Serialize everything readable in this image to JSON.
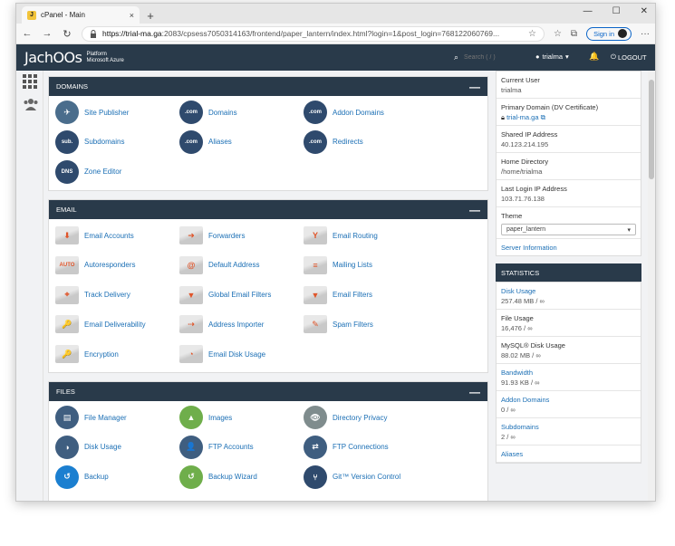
{
  "browser": {
    "tab_title": "cPanel - Main",
    "tab_close": "×",
    "new_tab": "+",
    "win_min": "—",
    "win_max": "☐",
    "win_close": "✕",
    "nav_back": "←",
    "nav_forward": "→",
    "nav_reload": "↻",
    "url_host": "https://trial-ma.ga",
    "url_rest": ":2083/cpsess7050314163/frontend/paper_lantern/index.html?login=1&post_login=768122060769...",
    "signin_label": "Sign in",
    "more": "···"
  },
  "header": {
    "logo": "JachOOs",
    "logo_sub1": "Platform",
    "logo_sub2": "Microsoft Azure",
    "search_icon": "🔍",
    "search_placeholder": "Search ( / )",
    "user": "trialma",
    "user_icon": "👤",
    "caret": "▾",
    "bell": "🔔",
    "logout": "LOGOUT",
    "logout_icon": "⏻"
  },
  "leftbar": {
    "grid_icon": "▦",
    "users_icon": "👥"
  },
  "domains": {
    "title": "DOMAINS",
    "collapse": "—",
    "items": [
      {
        "label": "Site Publisher",
        "glyph": "✈"
      },
      {
        "label": "Domains",
        "glyph": ".com"
      },
      {
        "label": "Addon Domains",
        "glyph": ".com"
      },
      {
        "label": "Subdomains",
        "glyph": "sub."
      },
      {
        "label": "Aliases",
        "glyph": ".com"
      },
      {
        "label": "Redirects",
        "glyph": ".com"
      },
      {
        "label": "Zone Editor",
        "glyph": "DNS"
      }
    ]
  },
  "email": {
    "title": "EMAIL",
    "collapse": "—",
    "items": [
      {
        "label": "Email Accounts",
        "glyph": "⬇"
      },
      {
        "label": "Forwarders",
        "glyph": "➜"
      },
      {
        "label": "Email Routing",
        "glyph": "Y"
      },
      {
        "label": "Autoresponders",
        "glyph": "AUTO"
      },
      {
        "label": "Default Address",
        "glyph": "@"
      },
      {
        "label": "Mailing Lists",
        "glyph": "≡"
      },
      {
        "label": "Track Delivery",
        "glyph": "⌖"
      },
      {
        "label": "Global Email Filters",
        "glyph": "▼"
      },
      {
        "label": "Email Filters",
        "glyph": "▼"
      },
      {
        "label": "Email Deliverability",
        "glyph": "🔑"
      },
      {
        "label": "Address Importer",
        "glyph": "⇢"
      },
      {
        "label": "Spam Filters",
        "glyph": "✎"
      },
      {
        "label": "Encryption",
        "glyph": "🔑"
      },
      {
        "label": "Email Disk Usage",
        "glyph": "◔"
      }
    ]
  },
  "files": {
    "title": "FILES",
    "collapse": "—",
    "items": [
      {
        "label": "File Manager",
        "glyph": "▤"
      },
      {
        "label": "Images",
        "glyph": "▲"
      },
      {
        "label": "Directory Privacy",
        "glyph": "👁"
      },
      {
        "label": "Disk Usage",
        "glyph": "◑"
      },
      {
        "label": "FTP Accounts",
        "glyph": "👤"
      },
      {
        "label": "FTP Connections",
        "glyph": "⇄"
      },
      {
        "label": "Backup",
        "glyph": "↺"
      },
      {
        "label": "Backup Wizard",
        "glyph": "↺"
      },
      {
        "label": "Git™ Version Control",
        "glyph": "⑂"
      }
    ]
  },
  "general": {
    "current_user_label": "Current User",
    "current_user": "trialma",
    "primary_domain_label": "Primary Domain (DV Certificate)",
    "primary_domain": "trial-ma.ga",
    "shared_ip_label": "Shared IP Address",
    "shared_ip": "40.123.214.195",
    "home_dir_label": "Home Directory",
    "home_dir": "/home/trialma",
    "last_login_label": "Last Login IP Address",
    "last_login": "103.71.76.138",
    "theme_label": "Theme",
    "theme_value": "paper_lantern",
    "server_info": "Server Information"
  },
  "stats": {
    "title": "STATISTICS",
    "rows": [
      {
        "label": "Disk Usage",
        "value": "257.48 MB / ∞",
        "link": true
      },
      {
        "label": "File Usage",
        "value": "16,476 / ∞",
        "link": false
      },
      {
        "label": "MySQL® Disk Usage",
        "value": "88.02 MB / ∞",
        "link": false
      },
      {
        "label": "Bandwidth",
        "value": "91.93 KB / ∞",
        "link": true
      },
      {
        "label": "Addon Domains",
        "value": "0 / ∞",
        "link": true
      },
      {
        "label": "Subdomains",
        "value": "2 / ∞",
        "link": true
      },
      {
        "label": "Aliases",
        "value": "",
        "link": true
      }
    ]
  },
  "colors": {
    "header": "#293a4a",
    "link": "#1b6fb5",
    "icon_blue": "#2f4a6d",
    "icon_green": "#6fae4b",
    "icon_orange": "#e0552a"
  }
}
